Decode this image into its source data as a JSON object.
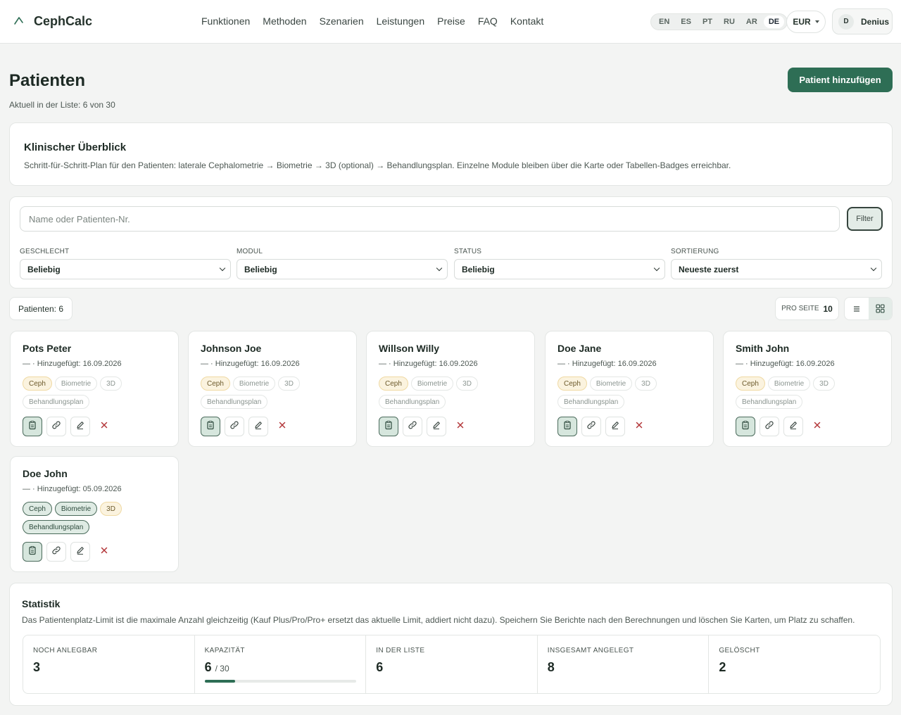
{
  "brand": {
    "name": "CephCalc"
  },
  "nav": [
    "Funktionen",
    "Methoden",
    "Szenarien",
    "Leistungen",
    "Preise",
    "FAQ",
    "Kontakt"
  ],
  "languages": {
    "items": [
      "EN",
      "ES",
      "PT",
      "RU",
      "AR",
      "DE"
    ],
    "active": "DE"
  },
  "currency": "EUR",
  "user": {
    "initial": "D",
    "name": "Denius"
  },
  "header": {
    "title": "Patienten",
    "subtitle": "Aktuell in der Liste: 6 von 30",
    "add_label": "Patient hinzufügen"
  },
  "overview": {
    "title": "Klinischer Überblick",
    "text": "Schritt-für-Schritt-Plan für den Patienten: laterale Cephalometrie → Biometrie → 3D (optional) → Behandlungsplan. Einzelne Module bleiben über die Karte oder Tabellen-Badges erreichbar."
  },
  "filters": {
    "search_placeholder": "Name oder Patienten-Nr.",
    "filter_label": "Filter",
    "groups": [
      {
        "label": "Geschlecht",
        "value": "Beliebig"
      },
      {
        "label": "Modul",
        "value": "Beliebig"
      },
      {
        "label": "Status",
        "value": "Beliebig"
      },
      {
        "label": "Sortierung",
        "value": "Neueste zuerst"
      }
    ]
  },
  "list": {
    "count_label": "Patienten: 6",
    "per_page_label": "PRO SEITE",
    "per_page_value": "10"
  },
  "patients": [
    {
      "name": "Pots Peter",
      "meta": "— · Hinzugefügt: 16.09.2026",
      "tags": [
        {
          "label": "Ceph",
          "state": "warn"
        },
        {
          "label": "Biometrie",
          "state": "off"
        },
        {
          "label": "3D",
          "state": "off"
        },
        {
          "label": "Behandlungsplan",
          "state": "off"
        }
      ]
    },
    {
      "name": "Johnson Joe",
      "meta": "— · Hinzugefügt: 16.09.2026",
      "tags": [
        {
          "label": "Ceph",
          "state": "warn"
        },
        {
          "label": "Biometrie",
          "state": "off"
        },
        {
          "label": "3D",
          "state": "off"
        },
        {
          "label": "Behandlungsplan",
          "state": "off"
        }
      ]
    },
    {
      "name": "Willson Willy",
      "meta": "— · Hinzugefügt: 16.09.2026",
      "tags": [
        {
          "label": "Ceph",
          "state": "warn"
        },
        {
          "label": "Biometrie",
          "state": "off"
        },
        {
          "label": "3D",
          "state": "off"
        },
        {
          "label": "Behandlungsplan",
          "state": "off"
        }
      ]
    },
    {
      "name": "Doe Jane",
      "meta": "— · Hinzugefügt: 16.09.2026",
      "tags": [
        {
          "label": "Ceph",
          "state": "warn"
        },
        {
          "label": "Biometrie",
          "state": "off"
        },
        {
          "label": "3D",
          "state": "off"
        },
        {
          "label": "Behandlungsplan",
          "state": "off"
        }
      ]
    },
    {
      "name": "Smith John",
      "meta": "— · Hinzugefügt: 16.09.2026",
      "tags": [
        {
          "label": "Ceph",
          "state": "warn"
        },
        {
          "label": "Biometrie",
          "state": "off"
        },
        {
          "label": "3D",
          "state": "off"
        },
        {
          "label": "Behandlungsplan",
          "state": "off"
        }
      ]
    },
    {
      "name": "Doe John",
      "meta": "— · Hinzugefügt: 05.09.2026",
      "tags": [
        {
          "label": "Ceph",
          "state": "done"
        },
        {
          "label": "Biometrie",
          "state": "done"
        },
        {
          "label": "3D",
          "state": "warn"
        },
        {
          "label": "Behandlungsplan",
          "state": "done"
        }
      ]
    }
  ],
  "stats": {
    "title": "Statistik",
    "text": "Das Patientenplatz-Limit ist die maximale Anzahl gleichzeitig (Kauf Plus/Pro/Pro+ ersetzt das aktuelle Limit, addiert nicht dazu). Speichern Sie Berichte nach den Berechnungen und löschen Sie Karten, um Platz zu schaffen.",
    "items": [
      {
        "label": "NOCH ANLEGBAR",
        "value": "3"
      },
      {
        "label": "KAPAZITÄT",
        "value": "6",
        "of": "/ 30",
        "fill": 0.2
      },
      {
        "label": "IN DER LISTE",
        "value": "6"
      },
      {
        "label": "INSGESAMT ANGELEGT",
        "value": "8"
      },
      {
        "label": "GELÖSCHT",
        "value": "2"
      }
    ]
  },
  "colors": {
    "accent": "#2e6e55",
    "warn_bg": "#fbf3df",
    "done_bg": "#dfebe4",
    "delete": "#b3373a"
  }
}
